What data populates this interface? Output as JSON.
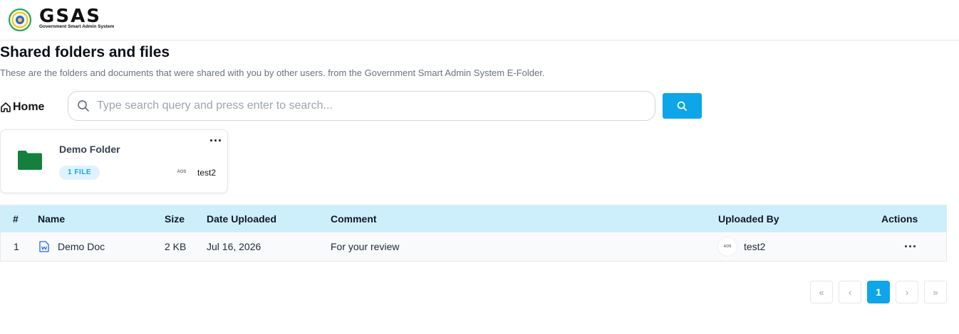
{
  "header": {
    "logo_icon": "national-seal-icon",
    "brand": "GSAS",
    "brand_subtitle": "Government Smart Admin System"
  },
  "page": {
    "title": "Shared folders and files",
    "description": "These are the folders and documents that were shared with you by other users. from the Government Smart Admin System E-Folder."
  },
  "breadcrumb": {
    "home_label": "Home",
    "home_icon": "home-icon"
  },
  "search": {
    "placeholder": "Type search query and press enter to search...",
    "value": "",
    "button_icon": "search-icon"
  },
  "folders": [
    {
      "name": "Demo Folder",
      "file_count": "1 FILE",
      "owner_avatar": "AOS",
      "owner": "test2",
      "icon": "folder-icon",
      "color": "#15803d"
    }
  ],
  "table": {
    "columns": [
      "#",
      "Name",
      "Size",
      "Date Uploaded",
      "Comment",
      "Uploaded By",
      "Actions"
    ],
    "rows": [
      {
        "index": "1",
        "name": "Demo Doc",
        "icon": "word-document-icon",
        "size": "2 KB",
        "date": "Jul 16, 2026",
        "comment": "For your review",
        "uploader_avatar": "AOS",
        "uploaded_by": "test2",
        "actions": "···"
      }
    ]
  },
  "pagination": {
    "first": "«",
    "prev": "‹",
    "current": "1",
    "next": "›",
    "last": "»"
  },
  "colors": {
    "accent": "#0ea5e9",
    "table_header_bg": "#cdeffc",
    "folder": "#15803d"
  }
}
